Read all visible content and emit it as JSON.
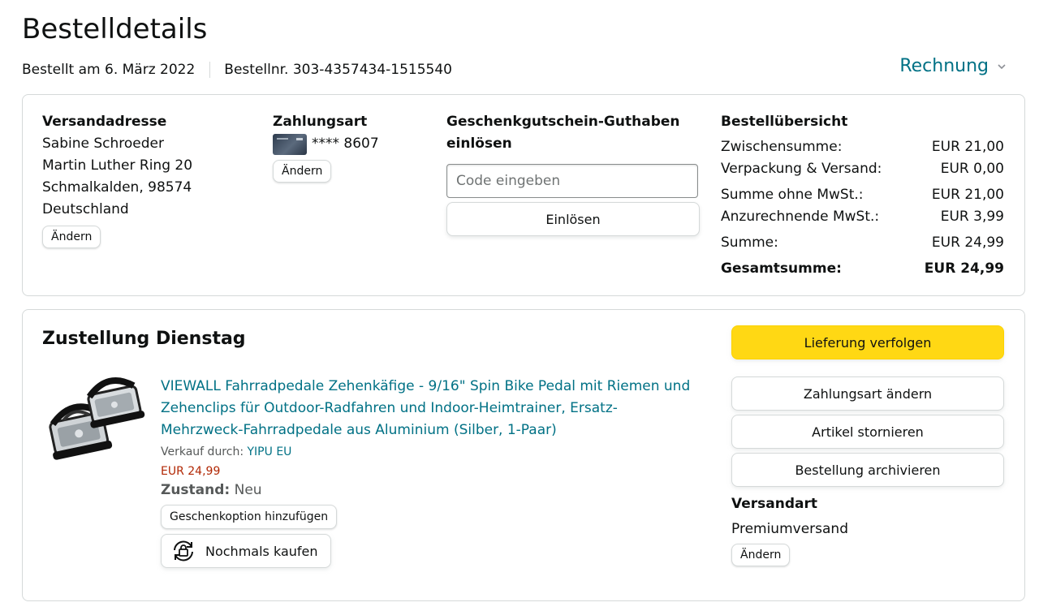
{
  "page": {
    "title": "Bestelldetails",
    "order_date": "Bestellt am 6. März 2022",
    "order_number": "Bestellnr. 303-4357434-1515540",
    "invoice_label": "Rechnung"
  },
  "shipping_address": {
    "heading": "Versandadresse",
    "lines": [
      "Sabine Schroeder",
      "Martin Luther Ring 20",
      "Schmalkalden, 98574",
      "Deutschland"
    ],
    "change_label": "Ändern"
  },
  "payment": {
    "heading": "Zahlungsart",
    "card_masked": "**** 8607",
    "card_icon": "credit-card-icon",
    "change_label": "Ändern"
  },
  "gift_card": {
    "heading_line1": "Geschenkgutschein-Guthaben",
    "heading_line2": "einlösen",
    "placeholder": "Code eingeben",
    "redeem_label": "Einlösen"
  },
  "summary": {
    "heading": "Bestellübersicht",
    "rows": [
      {
        "label": "Zwischensumme:",
        "value": "EUR 21,00"
      },
      {
        "label": "Verpackung & Versand:",
        "value": "EUR 0,00"
      },
      {
        "label": "Summe ohne MwSt.:",
        "value": "EUR 21,00"
      },
      {
        "label": "Anzurechnende MwSt.:",
        "value": "EUR 3,99"
      },
      {
        "label": "Summe:",
        "value": "EUR 24,99"
      },
      {
        "label": "Gesamtsumme:",
        "value": "EUR 24,99"
      }
    ]
  },
  "delivery": {
    "title": "Zustellung Dienstag",
    "product": {
      "title": "VIEWALL Fahrradpedale Zehenkäfige - 9/16\" Spin Bike Pedal mit Riemen und Zehenclips für Outdoor-Radfahren und Indoor-Heimtrainer, Ersatz-Mehrzweck-Fahrradpedale aus Aluminium (Silber, 1-Paar)",
      "title_lines": [
        "VIEWALL Fahrradpedale Zehenkäfige - 9/16\" Spin Bike Pedal mit Riemen und",
        "Zehenclips für Outdoor-Radfahren und Indoor-Heimtrainer, Ersatz-",
        "Mehrzweck-Fahrradpedale aus Aluminium (Silber, 1-Paar)"
      ],
      "sold_by_label": "Verkauf durch:",
      "seller": "YIPU EU",
      "price": "EUR 24,99",
      "condition_label": "Zustand:",
      "condition_value": "Neu",
      "gift_option_label": "Geschenkoption hinzufügen",
      "buy_again_label": "Nochmals kaufen",
      "buy_again_icon": "buy-again-icon"
    },
    "actions": {
      "track": "Lieferung verfolgen",
      "change_payment": "Zahlungsart ändern",
      "cancel": "Artikel stornieren",
      "archive": "Bestellung archivieren"
    },
    "shipping_method": {
      "heading": "Versandart",
      "value": "Premiumversand",
      "change_label": "Ändern"
    }
  },
  "colors": {
    "link": "#007185",
    "price": "#b12704",
    "primary_button": "#ffd814",
    "border": "#d5d9d9"
  }
}
